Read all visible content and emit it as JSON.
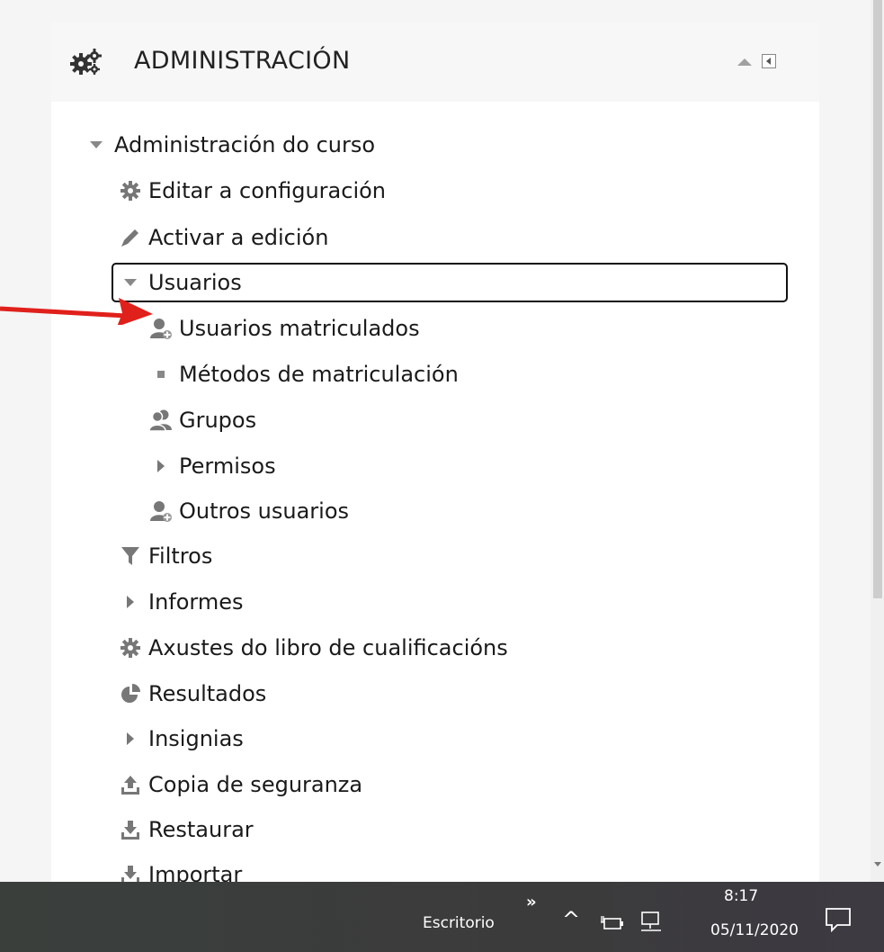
{
  "block": {
    "title": "ADMINISTRACIÓN",
    "icon": "gears-icon"
  },
  "tree": [
    {
      "label": "Administración do curso",
      "icon": "triangle-down-icon"
    },
    {
      "label": "Editar a configuración",
      "icon": "gear-icon"
    },
    {
      "label": "Activar a edición",
      "icon": "pencil-icon"
    },
    {
      "label": "Usuarios",
      "icon": "triangle-down-icon"
    },
    {
      "label": "Usuarios matriculados",
      "icon": "user-add-icon"
    },
    {
      "label": "Métodos de matriculación",
      "icon": "bullet-icon"
    },
    {
      "label": "Grupos",
      "icon": "users-group-icon"
    },
    {
      "label": "Permisos",
      "icon": "triangle-right-icon"
    },
    {
      "label": "Outros usuarios",
      "icon": "user-add-icon"
    },
    {
      "label": "Filtros",
      "icon": "filter-icon"
    },
    {
      "label": "Informes",
      "icon": "triangle-right-icon"
    },
    {
      "label": "Axustes do libro de cualificacións",
      "icon": "gear-icon"
    },
    {
      "label": "Resultados",
      "icon": "pie-chart-icon"
    },
    {
      "label": "Insignias",
      "icon": "triangle-right-icon"
    },
    {
      "label": "Copia de seguranza",
      "icon": "upload-icon"
    },
    {
      "label": "Restaurar",
      "icon": "download-icon"
    },
    {
      "label": "Importar",
      "icon": "download-icon"
    }
  ],
  "taskbar": {
    "desktop_label": "Escritorio",
    "chevrons": "»",
    "up_glyph": "^",
    "time": "8:17",
    "date": "05/11/2020"
  },
  "colors": {
    "accent_arrow": "#e0201b",
    "icon_gray": "#777777"
  }
}
